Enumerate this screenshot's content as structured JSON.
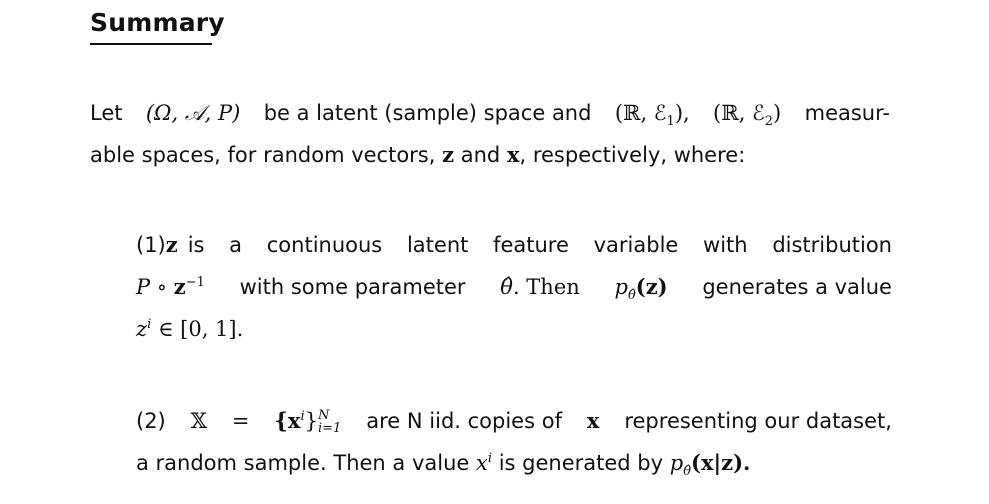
{
  "heading": "Summary",
  "intro": {
    "let": "Let",
    "omega_triple": "(Ω, 𝒜, P)",
    "be_latent": "be a latent (sample) space and",
    "space1": "(ℝ, ℰ",
    "sub1": "1",
    "space2": "(ℝ, ℰ",
    "sub2": "2",
    "measur": "measur-",
    "line2_a": "able spaces, for random vectors,",
    "z": "z",
    "and": "and",
    "x": "x",
    "line2_b": ", respectively, where:"
  },
  "item1": {
    "num": "(1)",
    "z": "z",
    "text_a": "is a continuous latent feature variable with distribution",
    "p_comp": "P ∘",
    "z2": "z",
    "sup_neg1": "−1",
    "text_b": "with some parameter",
    "theta_hat": "θ̂",
    "text_c": ". Then",
    "p": "p",
    "p_sub": "θ̂",
    "pz": "(z)",
    "text_d": "generates a value",
    "zi": "z",
    "zi_sup": "i",
    "interval": "∈ [0, 1]."
  },
  "item2": {
    "num": "(2)",
    "bbX": "𝕏",
    "eq": "=",
    "set_open": "{x",
    "set_sup": "i",
    "set_close": "}",
    "upper": "N",
    "lower": "i=1",
    "text_a": "are N iid.  copies of",
    "x": "x",
    "text_b": "representing our dataset,",
    "line2_a": "a random sample. Then a value",
    "xi": "x",
    "xi_sup": "i",
    "text_c": "is generated by",
    "p": "p",
    "p_sub": "θ̂",
    "pxz": "(x|z)."
  }
}
